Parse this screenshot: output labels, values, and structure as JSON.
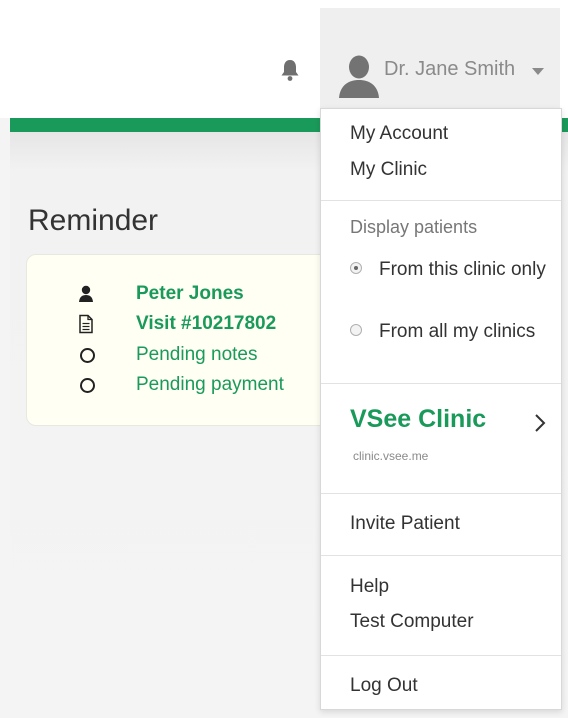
{
  "header": {
    "user_name": "Dr. Jane Smith",
    "icons": {
      "notifications": "bell-icon",
      "user": "avatar-icon",
      "dropdown": "caret-down-icon"
    }
  },
  "colors": {
    "brand_green": "#1a9a5a",
    "menu_bg": "#ffffff",
    "header_hover_bg": "#efefef"
  },
  "reminder": {
    "title": "Reminder",
    "items": [
      {
        "icon": "user-icon",
        "text": "Peter Jones"
      },
      {
        "icon": "document-icon",
        "text": "Visit #10217802"
      },
      {
        "icon": "circle-icon",
        "text": "Pending notes"
      },
      {
        "icon": "circle-icon",
        "text": "Pending payment"
      }
    ]
  },
  "menu": {
    "my_account": "My Account",
    "my_clinic": "My Clinic",
    "display_patients_header": "Display patients",
    "radio_this_clinic": "From this clinic only",
    "radio_all_clinics": "From all my clinics",
    "selected_option": "From this clinic only",
    "clinic_name": "VSee Clinic",
    "clinic_url": "clinic.vsee.me",
    "invite_patient": "Invite Patient",
    "help": "Help",
    "test_computer": "Test Computer",
    "log_out": "Log Out"
  }
}
